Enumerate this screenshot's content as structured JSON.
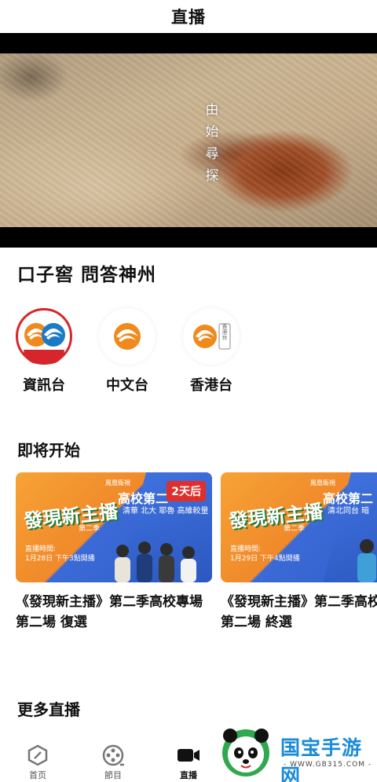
{
  "header": {
    "title": "直播"
  },
  "player": {
    "overlay_text": [
      "由",
      "始",
      "尋",
      "探"
    ]
  },
  "program": {
    "title": "口子窖 問答神州"
  },
  "channels": [
    {
      "name": "資訊台",
      "active": true
    },
    {
      "name": "中文台",
      "active": false
    },
    {
      "name": "香港台",
      "active": false,
      "logo_tag": "香港台"
    }
  ],
  "upcoming": {
    "title": "即将开始",
    "cards": [
      {
        "show_name": "發現新主播",
        "season_tag": "第二季",
        "top_tag": "鳳凰衛視",
        "headline": "高校第二",
        "sub": "清華 北大 耶魯 高維較量",
        "air_label": "直播時間:",
        "air_time": "1月28日 下午3點開播",
        "badge": "2天后",
        "caption": "《發現新主播》第二季高校專場第二場 復選"
      },
      {
        "show_name": "發現新主播",
        "season_tag": "第二季",
        "top_tag": "鳳凰衛視",
        "headline": "高校第二",
        "sub": "清北同台 暗",
        "air_label": "直播時間:",
        "air_time": "1月29日 下午4點開播",
        "badge": "",
        "caption": "《發現新主播》第二季高校專場第二場 終選"
      }
    ]
  },
  "more": {
    "title": "更多直播"
  },
  "tabbar": {
    "tabs": [
      {
        "label": "首页",
        "icon": "home-icon"
      },
      {
        "label": "節目",
        "icon": "film-reel-icon"
      },
      {
        "label": "直播",
        "icon": "video-camera-icon",
        "active": true
      }
    ]
  },
  "watermark": {
    "text": "国宝手游网",
    "url": "- WWW.GB315.COM -"
  },
  "colors": {
    "accent_red": "#d7262b",
    "phoenix_orange": "#f08a1c"
  }
}
